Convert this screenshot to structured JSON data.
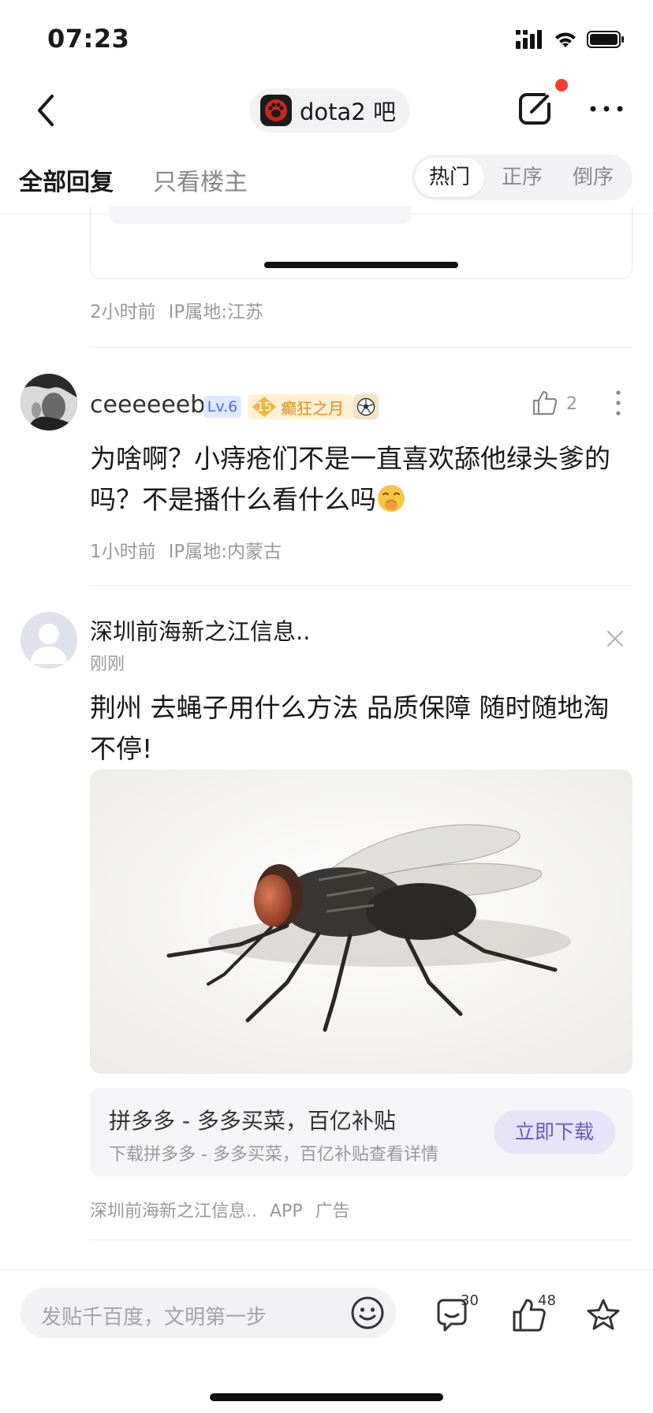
{
  "status_bar": {
    "time": "07:23"
  },
  "nav": {
    "forum_name": "dota2 吧"
  },
  "tabs": {
    "all_replies": "全部回复",
    "op_only": "只看楼主",
    "sort": {
      "hot": "热门",
      "asc": "正序",
      "desc": "倒序",
      "selected": "热门"
    }
  },
  "previous_post": {
    "time": "2小时前",
    "ip": "IP属地:江苏"
  },
  "reply": {
    "username": "ceeeeeeb",
    "level": "Lv.6",
    "title_level": "15",
    "title": "癫狂之月",
    "like_count": "2",
    "content": "为啥啊？小痔疮们不是一直喜欢舔他绿头爹的吗？不是播什么看什么吗",
    "emoji": "shushing-face",
    "time": "1小时前",
    "ip": "IP属地:内蒙古"
  },
  "ad": {
    "advertiser": "深圳前海新之江信息..",
    "time": "刚刚",
    "text": "荆州  去蝇子用什么方法 品质保障 随时随地淘不停!",
    "image": "housefly-photo",
    "app_title": "拼多多 - 多多买菜，百亿补贴",
    "app_subtitle": "下载拼多多 - 多多买菜，百亿补贴查看详情",
    "download_label": "立即下载",
    "footer_source": "深圳前海新之江信息..",
    "footer_app": "APP",
    "footer_ad": "广告"
  },
  "bottom_bar": {
    "input_placeholder": "发贴千百度，文明第一步",
    "comment_count": "30",
    "like_count": "48"
  },
  "colors": {
    "accent_purple": "#6a57cc",
    "notification_red": "#ff3b30",
    "level_blue": "#4a6ce8",
    "title_orange": "#e38c1d"
  }
}
